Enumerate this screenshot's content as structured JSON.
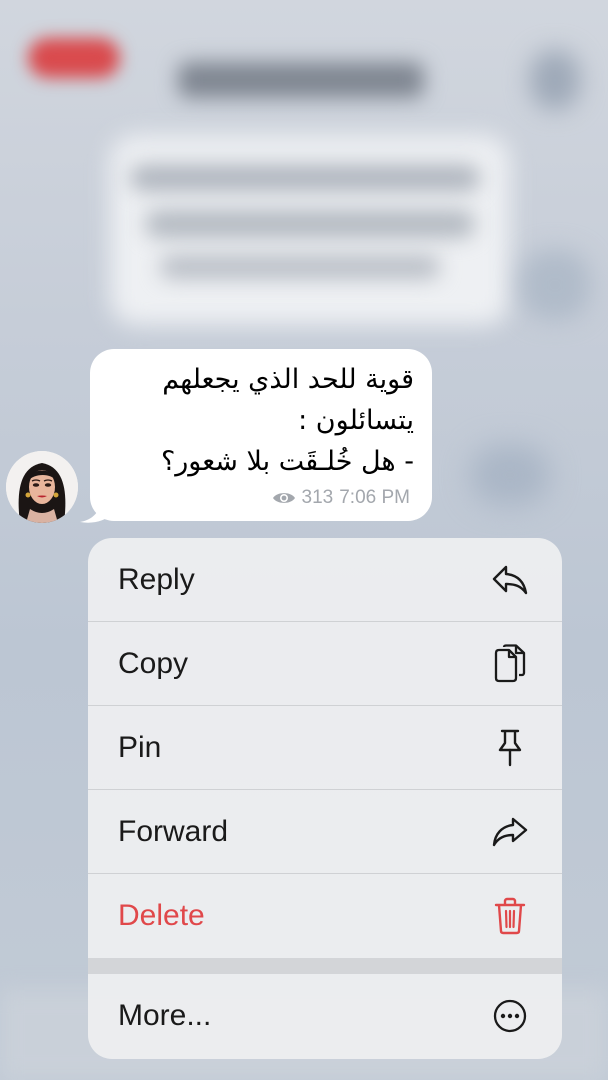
{
  "message": {
    "lines": [
      "قوية للحد الذي يجعلهم",
      "يتسائلون :",
      "- هل خُلـقَت بلا شعور؟"
    ],
    "views": "313",
    "time": "7:06 PM"
  },
  "menu": {
    "items": [
      {
        "label": "Reply",
        "icon": "reply-icon"
      },
      {
        "label": "Copy",
        "icon": "copy-icon"
      },
      {
        "label": "Pin",
        "icon": "pin-icon"
      },
      {
        "label": "Forward",
        "icon": "forward-icon"
      },
      {
        "label": "Delete",
        "icon": "trash-icon"
      }
    ],
    "more": {
      "label": "More...",
      "icon": "more-icon"
    }
  },
  "colors": {
    "danger": "#e0484a",
    "text": "#1a1a1a",
    "meta": "#a3a7ad"
  }
}
